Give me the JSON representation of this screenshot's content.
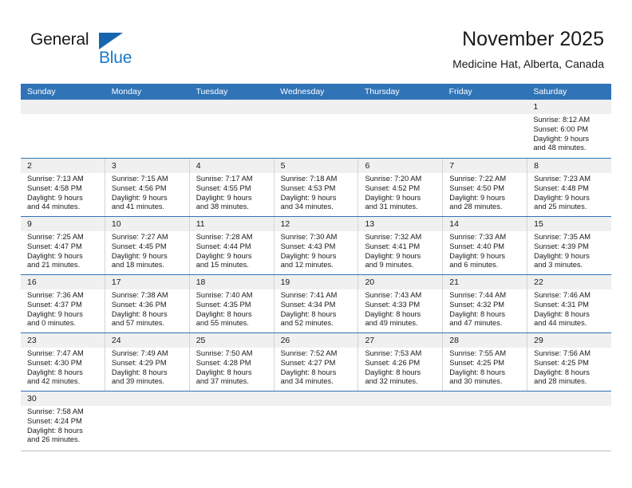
{
  "brand": {
    "word1": "General",
    "word2": "Blue",
    "triangle_color": "#1665ae",
    "blue_text_color": "#1878c8"
  },
  "header": {
    "title": "November 2025",
    "subtitle": "Medicine Hat, Alberta, Canada",
    "accent_color": "#3073b7",
    "daynumber_band_color": "#f0f0f0"
  },
  "weekdays": [
    "Sunday",
    "Monday",
    "Tuesday",
    "Wednesday",
    "Thursday",
    "Friday",
    "Saturday"
  ],
  "weeks": [
    [
      {
        "empty": true
      },
      {
        "empty": true
      },
      {
        "empty": true
      },
      {
        "empty": true
      },
      {
        "empty": true
      },
      {
        "empty": true
      },
      {
        "day": "1",
        "sunrise": "Sunrise: 8:12 AM",
        "sunset": "Sunset: 6:00 PM",
        "daylight1": "Daylight: 9 hours",
        "daylight2": "and 48 minutes."
      }
    ],
    [
      {
        "day": "2",
        "sunrise": "Sunrise: 7:13 AM",
        "sunset": "Sunset: 4:58 PM",
        "daylight1": "Daylight: 9 hours",
        "daylight2": "and 44 minutes."
      },
      {
        "day": "3",
        "sunrise": "Sunrise: 7:15 AM",
        "sunset": "Sunset: 4:56 PM",
        "daylight1": "Daylight: 9 hours",
        "daylight2": "and 41 minutes."
      },
      {
        "day": "4",
        "sunrise": "Sunrise: 7:17 AM",
        "sunset": "Sunset: 4:55 PM",
        "daylight1": "Daylight: 9 hours",
        "daylight2": "and 38 minutes."
      },
      {
        "day": "5",
        "sunrise": "Sunrise: 7:18 AM",
        "sunset": "Sunset: 4:53 PM",
        "daylight1": "Daylight: 9 hours",
        "daylight2": "and 34 minutes."
      },
      {
        "day": "6",
        "sunrise": "Sunrise: 7:20 AM",
        "sunset": "Sunset: 4:52 PM",
        "daylight1": "Daylight: 9 hours",
        "daylight2": "and 31 minutes."
      },
      {
        "day": "7",
        "sunrise": "Sunrise: 7:22 AM",
        "sunset": "Sunset: 4:50 PM",
        "daylight1": "Daylight: 9 hours",
        "daylight2": "and 28 minutes."
      },
      {
        "day": "8",
        "sunrise": "Sunrise: 7:23 AM",
        "sunset": "Sunset: 4:48 PM",
        "daylight1": "Daylight: 9 hours",
        "daylight2": "and 25 minutes."
      }
    ],
    [
      {
        "day": "9",
        "sunrise": "Sunrise: 7:25 AM",
        "sunset": "Sunset: 4:47 PM",
        "daylight1": "Daylight: 9 hours",
        "daylight2": "and 21 minutes."
      },
      {
        "day": "10",
        "sunrise": "Sunrise: 7:27 AM",
        "sunset": "Sunset: 4:45 PM",
        "daylight1": "Daylight: 9 hours",
        "daylight2": "and 18 minutes."
      },
      {
        "day": "11",
        "sunrise": "Sunrise: 7:28 AM",
        "sunset": "Sunset: 4:44 PM",
        "daylight1": "Daylight: 9 hours",
        "daylight2": "and 15 minutes."
      },
      {
        "day": "12",
        "sunrise": "Sunrise: 7:30 AM",
        "sunset": "Sunset: 4:43 PM",
        "daylight1": "Daylight: 9 hours",
        "daylight2": "and 12 minutes."
      },
      {
        "day": "13",
        "sunrise": "Sunrise: 7:32 AM",
        "sunset": "Sunset: 4:41 PM",
        "daylight1": "Daylight: 9 hours",
        "daylight2": "and 9 minutes."
      },
      {
        "day": "14",
        "sunrise": "Sunrise: 7:33 AM",
        "sunset": "Sunset: 4:40 PM",
        "daylight1": "Daylight: 9 hours",
        "daylight2": "and 6 minutes."
      },
      {
        "day": "15",
        "sunrise": "Sunrise: 7:35 AM",
        "sunset": "Sunset: 4:39 PM",
        "daylight1": "Daylight: 9 hours",
        "daylight2": "and 3 minutes."
      }
    ],
    [
      {
        "day": "16",
        "sunrise": "Sunrise: 7:36 AM",
        "sunset": "Sunset: 4:37 PM",
        "daylight1": "Daylight: 9 hours",
        "daylight2": "and 0 minutes."
      },
      {
        "day": "17",
        "sunrise": "Sunrise: 7:38 AM",
        "sunset": "Sunset: 4:36 PM",
        "daylight1": "Daylight: 8 hours",
        "daylight2": "and 57 minutes."
      },
      {
        "day": "18",
        "sunrise": "Sunrise: 7:40 AM",
        "sunset": "Sunset: 4:35 PM",
        "daylight1": "Daylight: 8 hours",
        "daylight2": "and 55 minutes."
      },
      {
        "day": "19",
        "sunrise": "Sunrise: 7:41 AM",
        "sunset": "Sunset: 4:34 PM",
        "daylight1": "Daylight: 8 hours",
        "daylight2": "and 52 minutes."
      },
      {
        "day": "20",
        "sunrise": "Sunrise: 7:43 AM",
        "sunset": "Sunset: 4:33 PM",
        "daylight1": "Daylight: 8 hours",
        "daylight2": "and 49 minutes."
      },
      {
        "day": "21",
        "sunrise": "Sunrise: 7:44 AM",
        "sunset": "Sunset: 4:32 PM",
        "daylight1": "Daylight: 8 hours",
        "daylight2": "and 47 minutes."
      },
      {
        "day": "22",
        "sunrise": "Sunrise: 7:46 AM",
        "sunset": "Sunset: 4:31 PM",
        "daylight1": "Daylight: 8 hours",
        "daylight2": "and 44 minutes."
      }
    ],
    [
      {
        "day": "23",
        "sunrise": "Sunrise: 7:47 AM",
        "sunset": "Sunset: 4:30 PM",
        "daylight1": "Daylight: 8 hours",
        "daylight2": "and 42 minutes."
      },
      {
        "day": "24",
        "sunrise": "Sunrise: 7:49 AM",
        "sunset": "Sunset: 4:29 PM",
        "daylight1": "Daylight: 8 hours",
        "daylight2": "and 39 minutes."
      },
      {
        "day": "25",
        "sunrise": "Sunrise: 7:50 AM",
        "sunset": "Sunset: 4:28 PM",
        "daylight1": "Daylight: 8 hours",
        "daylight2": "and 37 minutes."
      },
      {
        "day": "26",
        "sunrise": "Sunrise: 7:52 AM",
        "sunset": "Sunset: 4:27 PM",
        "daylight1": "Daylight: 8 hours",
        "daylight2": "and 34 minutes."
      },
      {
        "day": "27",
        "sunrise": "Sunrise: 7:53 AM",
        "sunset": "Sunset: 4:26 PM",
        "daylight1": "Daylight: 8 hours",
        "daylight2": "and 32 minutes."
      },
      {
        "day": "28",
        "sunrise": "Sunrise: 7:55 AM",
        "sunset": "Sunset: 4:25 PM",
        "daylight1": "Daylight: 8 hours",
        "daylight2": "and 30 minutes."
      },
      {
        "day": "29",
        "sunrise": "Sunrise: 7:56 AM",
        "sunset": "Sunset: 4:25 PM",
        "daylight1": "Daylight: 8 hours",
        "daylight2": "and 28 minutes."
      }
    ],
    [
      {
        "day": "30",
        "sunrise": "Sunrise: 7:58 AM",
        "sunset": "Sunset: 4:24 PM",
        "daylight1": "Daylight: 8 hours",
        "daylight2": "and 26 minutes."
      },
      {
        "empty": true
      },
      {
        "empty": true
      },
      {
        "empty": true
      },
      {
        "empty": true
      },
      {
        "empty": true
      },
      {
        "empty": true
      }
    ]
  ]
}
